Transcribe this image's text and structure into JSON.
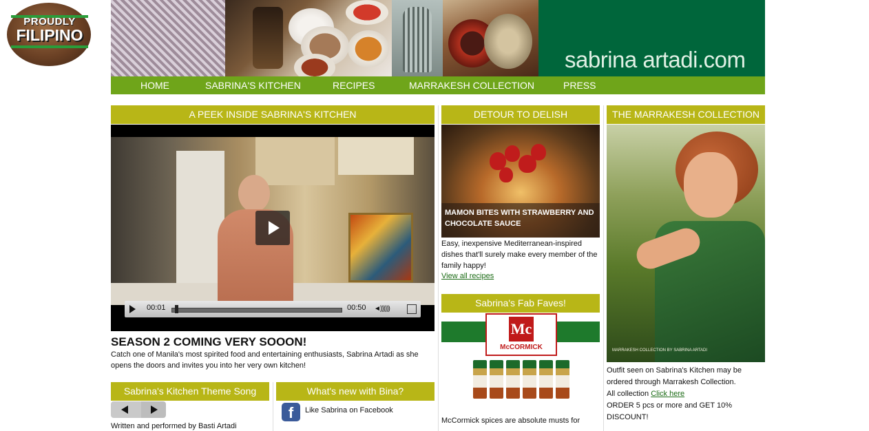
{
  "logo": {
    "line1": "PROUDLY",
    "line2": "FILIPINO"
  },
  "header": {
    "site_name": "sabrina artadi.com",
    "banner_color": "#00663b"
  },
  "nav": {
    "color": "#6fa51a",
    "items": [
      {
        "label": "HOME"
      },
      {
        "label": "SABRINA'S KITCHEN"
      },
      {
        "label": "RECIPES"
      },
      {
        "label": "MARRAKESH COLLECTION"
      },
      {
        "label": "PRESS"
      }
    ]
  },
  "section_color": "#b8b617",
  "kitchen": {
    "title": "A PEEK INSIDE SABRINA'S KITCHEN",
    "video": {
      "current_time": "00:01",
      "duration": "00:50",
      "progress": 0.02
    },
    "headline": "SEASON 2 COMING VERY SOOON!",
    "description": "Catch one of Manila's most spirited food and entertaining enthusiasts, Sabrina Artadi as she opens the doors and invites you into her very own kitchen!"
  },
  "theme_song": {
    "title": "Sabrina's Kitchen Theme Song",
    "credit": "Written and performed by Basti Artadi"
  },
  "whats_new": {
    "title": "What's new with Bina?",
    "facebook_label": "Like Sabrina on Facebook",
    "facebook_glyph": "f"
  },
  "detour": {
    "title": "DETOUR TO DELISH",
    "caption": "MAMON BITES WITH STRAWBERRY AND CHOCOLATE SAUCE",
    "description": "Easy, inexpensive Mediterranean-inspired dishes that'll surely make every member of the family happy!",
    "link": "View all recipes"
  },
  "fab_faves": {
    "title": "Sabrina's Fab Faves!",
    "brand_mark": "Mc",
    "brand_name": "McCORMICK",
    "description": "McCormick spices are absolute musts for"
  },
  "marrakesh": {
    "title": "THE MARRAKESH COLLECTION",
    "photo_caption": "MARRAKESH COLLECTION BY SABRINA ARTADI",
    "text1": "Outfit seen on Sabrina's Kitchen may be ordered through Marrakesh Collection.",
    "text2_prefix": "All collection ",
    "text2_link": "Click here",
    "text3": "ORDER 5 pcs or more and GET 10% DISCOUNT!"
  }
}
